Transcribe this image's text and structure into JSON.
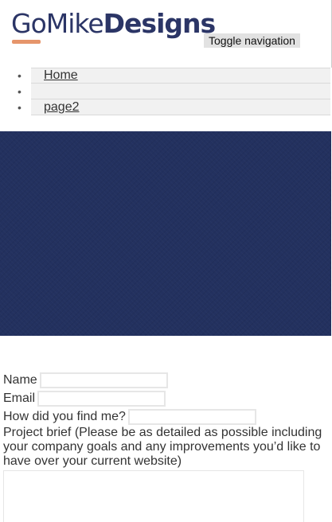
{
  "header": {
    "logo": {
      "go": "Go",
      "mike": "Mike",
      "designs": "Designs",
      "accent_color": "#e6956b",
      "brand_color": "#2b3566"
    },
    "toggle_label": "Toggle navigation"
  },
  "nav": {
    "items": [
      {
        "label": "Home"
      },
      {
        "label": ""
      },
      {
        "label": "page2"
      }
    ]
  },
  "hero": {
    "color": "#23315f"
  },
  "form": {
    "name_label": "Name",
    "email_label": "Email",
    "find_label": "How did you find me?",
    "brief_label": "Project brief (Please be as detailed as possible including your company goals and any improvements you’d like to have over your current website)",
    "name_value": "",
    "email_value": "",
    "find_value": "",
    "brief_value": ""
  }
}
